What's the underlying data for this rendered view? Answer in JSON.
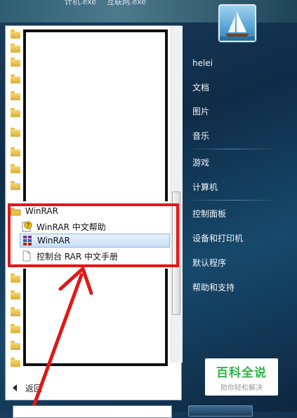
{
  "taskbar_captions": [
    "计机.exe",
    "互联网.exe"
  ],
  "left_pane": {
    "folder_count": 17,
    "submenu": {
      "folder_label": "WinRAR",
      "items": [
        {
          "label": "WinRAR 中文帮助",
          "icon": "help-icon"
        },
        {
          "label": "WinRAR",
          "icon": "winrar-icon",
          "highlighted": true
        },
        {
          "label": "控制台 RAR 中文手册",
          "icon": "document-icon"
        }
      ]
    },
    "back_label": "返回"
  },
  "right_pane": {
    "user_name": "helei",
    "items": [
      "文档",
      "图片",
      "音乐",
      "游戏",
      "计算机",
      "控制面板",
      "设备和打印机",
      "默认程序",
      "帮助和支持"
    ]
  },
  "watermark": {
    "title": "百科全说",
    "subtitle": "助你轻松解决"
  },
  "annotation_color": "#e01818"
}
